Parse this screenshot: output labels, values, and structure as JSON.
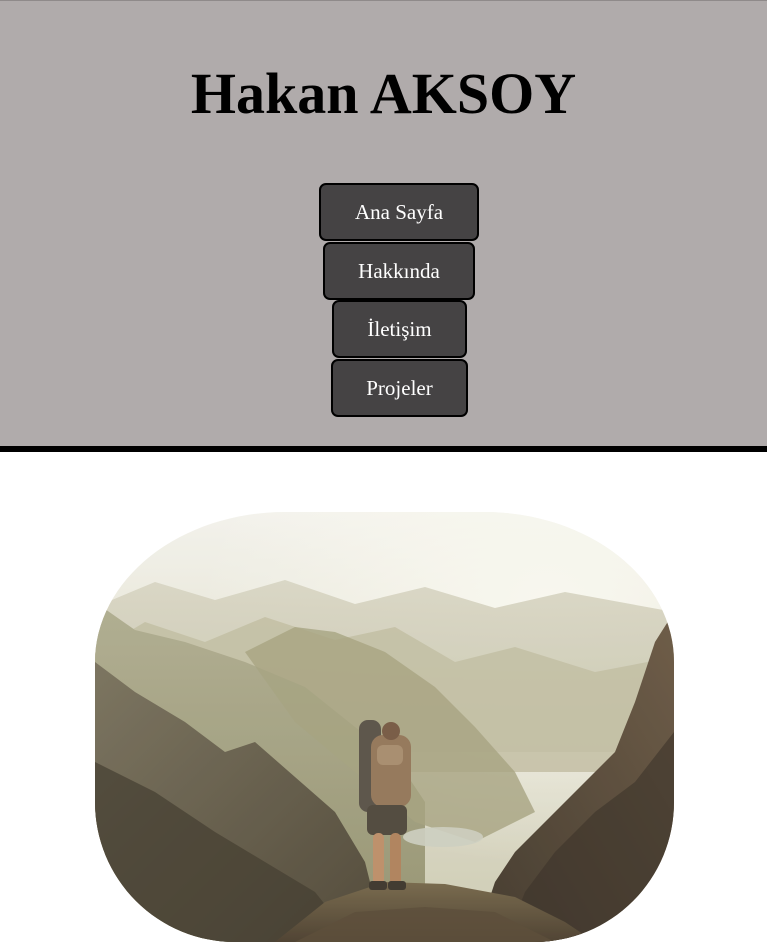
{
  "header": {
    "title": "Hakan AKSOY",
    "background_color": "#b0abab"
  },
  "nav": {
    "items": [
      {
        "label": "Ana Sayfa"
      },
      {
        "label": "Hakkında"
      },
      {
        "label": "İletişim"
      },
      {
        "label": "Projeler"
      }
    ],
    "button_color": "#454344"
  },
  "hero": {
    "image": "mountain-hiker-photo"
  }
}
